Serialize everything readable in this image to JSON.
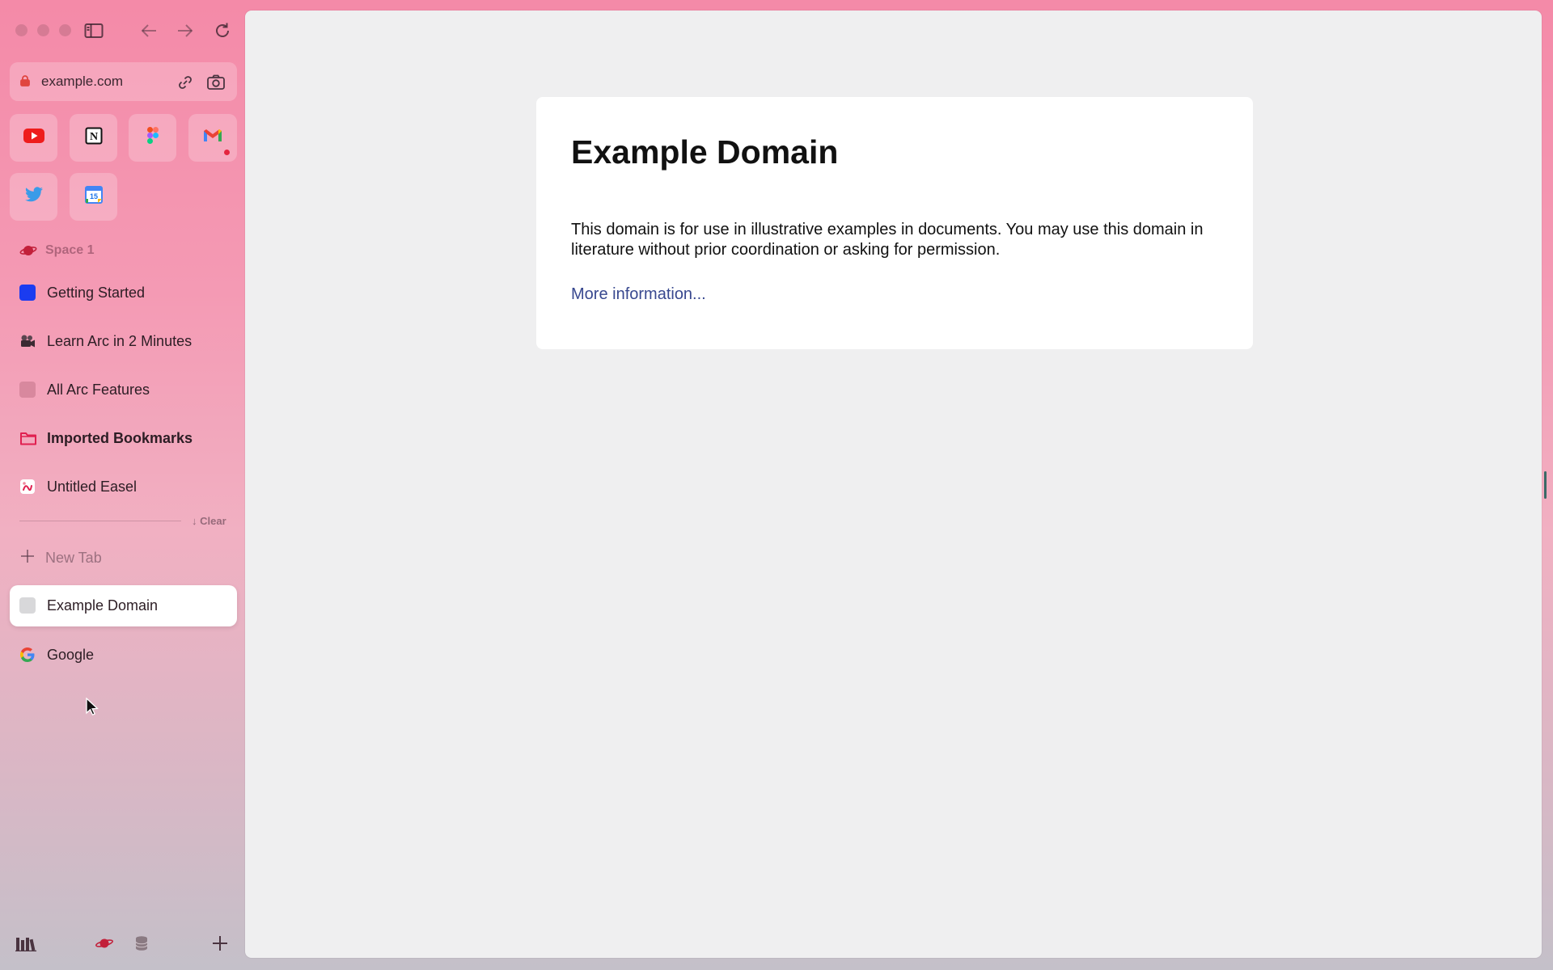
{
  "browser": {
    "url": "example.com",
    "space_name": "Space 1"
  },
  "favorites": [
    {
      "name": "YouTube",
      "icon": "youtube-icon"
    },
    {
      "name": "Notion",
      "icon": "notion-icon"
    },
    {
      "name": "Figma",
      "icon": "figma-icon"
    },
    {
      "name": "Gmail",
      "icon": "gmail-icon"
    },
    {
      "name": "Twitter",
      "icon": "twitter-icon"
    },
    {
      "name": "Calendar",
      "icon": "calendar-icon",
      "badge": "15"
    }
  ],
  "pinned_tabs": [
    {
      "label": "Getting Started",
      "icon": "blue-square-icon"
    },
    {
      "label": "Learn Arc in 2 Minutes",
      "icon": "camera-icon"
    },
    {
      "label": "All Arc Features",
      "icon": "pink-square-icon"
    },
    {
      "label": "Imported Bookmarks",
      "icon": "folder-icon"
    },
    {
      "label": "Untitled Easel",
      "icon": "easel-icon"
    }
  ],
  "clear_label": "↓ Clear",
  "new_tab_label": "New Tab",
  "open_tabs": [
    {
      "label": "Example Domain",
      "icon": "page-icon",
      "active": true
    },
    {
      "label": "Google",
      "icon": "google-icon",
      "active": false
    }
  ],
  "page": {
    "title": "Example Domain",
    "body": "This domain is for use in illustrative examples in documents. You may use this domain in literature without prior coordination or asking for permission.",
    "link": "More information..."
  },
  "colors": {
    "accent_link": "#38488f",
    "youtube_red": "#ee1c1c",
    "twitter_blue": "#3a9be8",
    "getting_started_blue": "#1b3cf0",
    "folder_red": "#e02050"
  }
}
